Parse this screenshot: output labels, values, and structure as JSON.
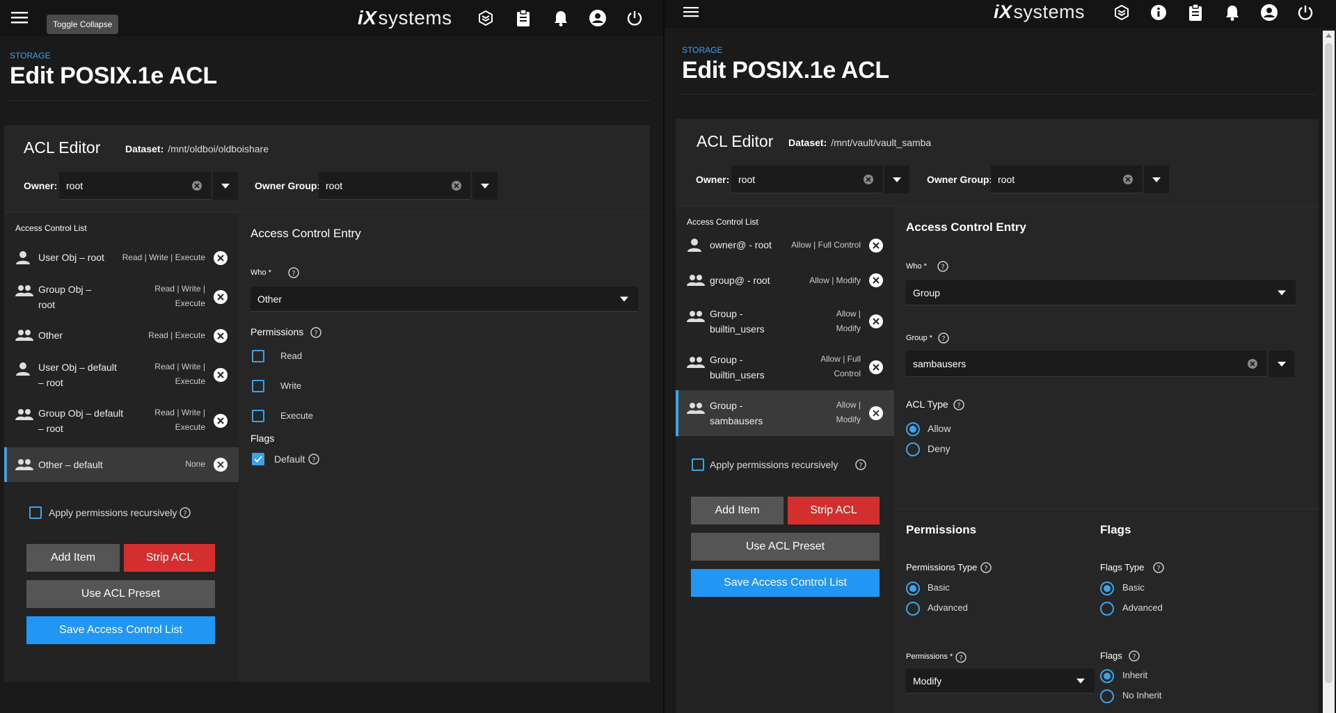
{
  "brand": {
    "ix": "iX",
    "systems": "systems"
  },
  "left": {
    "tooltip": "Toggle Collapse",
    "breadcrumb": "STORAGE",
    "title": "Edit POSIX.1e ACL",
    "editor_title": "ACL Editor",
    "dataset_label": "Dataset:",
    "dataset_value": "/mnt/oldboi/oldboishare",
    "owner_label": "Owner:",
    "owner_value": "root",
    "owner_group_label": "Owner Group:",
    "owner_group_value": "root",
    "list_header": "Access Control List",
    "entries": [
      {
        "who": "User Obj – root",
        "perm": "Read | Write | Execute",
        "icon": "person-icon"
      },
      {
        "who": "Group Obj –\nroot",
        "perm": "Read | Write |\nExecute",
        "icon": "group-icon"
      },
      {
        "who": "Other",
        "perm": "Read | Execute",
        "icon": "group-icon"
      },
      {
        "who": "User Obj – default\n– root",
        "perm": "Read | Write |\nExecute",
        "icon": "person-icon"
      },
      {
        "who": "Group Obj – default\n– root",
        "perm": "Read | Write |\nExecute",
        "icon": "group-icon"
      },
      {
        "who": "Other – default",
        "perm": "None",
        "icon": "group-icon",
        "selected": true
      }
    ],
    "apply_recursive": "Apply permissions recursively",
    "btn_add": "Add Item",
    "btn_strip": "Strip ACL",
    "btn_preset": "Use ACL Preset",
    "btn_save": "Save Access Control List",
    "ace_title": "Access Control Entry",
    "who_label": "Who *",
    "who_value": "Other",
    "permissions_label": "Permissions",
    "perm_read": "Read",
    "perm_write": "Write",
    "perm_execute": "Execute",
    "flags_label": "Flags",
    "flag_default": "Default"
  },
  "right": {
    "breadcrumb": "STORAGE",
    "title": "Edit POSIX.1e ACL",
    "editor_title": "ACL Editor",
    "dataset_label": "Dataset:",
    "dataset_value": "/mnt/vault/vault_samba",
    "owner_label": "Owner:",
    "owner_value": "root",
    "owner_group_label": "Owner Group:",
    "owner_group_value": "root",
    "list_header": "Access Control List",
    "entries": [
      {
        "who": "owner@ - root",
        "perm": "Allow | Full Control",
        "icon": "person-icon"
      },
      {
        "who": "group@ - root",
        "perm": "Allow | Modify",
        "icon": "group-icon"
      },
      {
        "who": "Group -\nbuiltin_users",
        "perm": "Allow |\nModify",
        "icon": "group-icon"
      },
      {
        "who": "Group -\nbuiltin_users",
        "perm": "Allow | Full\nControl",
        "icon": "group-icon"
      },
      {
        "who": "Group -\nsambausers",
        "perm": "Allow |\nModify",
        "icon": "group-icon",
        "selected": true
      }
    ],
    "apply_recursive": "Apply permissions recursively",
    "btn_add": "Add Item",
    "btn_strip": "Strip ACL",
    "btn_preset": "Use ACL Preset",
    "btn_save": "Save Access Control List",
    "ace_title": "Access Control Entry",
    "who_label": "Who *",
    "who_value": "Group",
    "group_label": "Group *",
    "group_value": "sambausers",
    "acl_type_label": "ACL Type",
    "acl_allow": "Allow",
    "acl_deny": "Deny",
    "permissions_title": "Permissions",
    "flags_title": "Flags",
    "perm_type_label": "Permissions Type",
    "perm_basic": "Basic",
    "perm_advanced": "Advanced",
    "flags_type_label": "Flags Type",
    "flags_basic": "Basic",
    "flags_advanced": "Advanced",
    "permissions_sel_label": "Permissions *",
    "permissions_sel_value": "Modify",
    "flags_label": "Flags",
    "flag_inherit": "Inherit",
    "flag_no_inherit": "No Inherit"
  }
}
